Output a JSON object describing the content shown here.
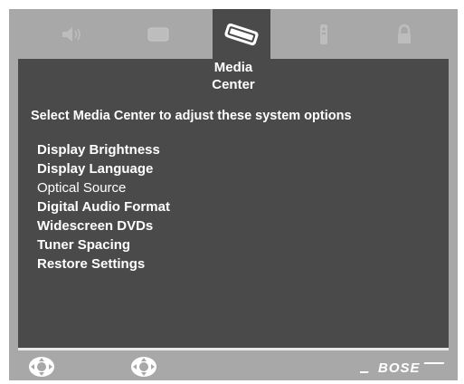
{
  "tabs": [
    {
      "icon": "speaker-icon",
      "active": false
    },
    {
      "icon": "tv-icon",
      "active": false
    },
    {
      "icon": "media-center-icon",
      "active": true
    },
    {
      "icon": "remote-icon",
      "active": false
    },
    {
      "icon": "lock-icon",
      "active": false
    }
  ],
  "panel": {
    "title_line1": "Media",
    "title_line2": "Center",
    "instruction": "Select Media Center to adjust these system options",
    "options": [
      {
        "label": "Display Brightness",
        "style": "bold"
      },
      {
        "label": "Display Language",
        "style": "bold"
      },
      {
        "label": "Optical Source",
        "style": "normal"
      },
      {
        "label": "Digital Audio Format",
        "style": "bold"
      },
      {
        "label": "Widescreen DVDs",
        "style": "bold"
      },
      {
        "label": "Tuner Spacing",
        "style": "bold"
      },
      {
        "label": "Restore Settings",
        "style": "bold"
      }
    ]
  },
  "footer": {
    "nav_left_icon": "directional-pad-icon",
    "nav_right_icon": "directional-pad-icon",
    "brand": "BOSE"
  },
  "colors": {
    "panel_bg": "#4a4a4a",
    "frame_bg": "#a8a8a8",
    "text": "#ffffff"
  }
}
